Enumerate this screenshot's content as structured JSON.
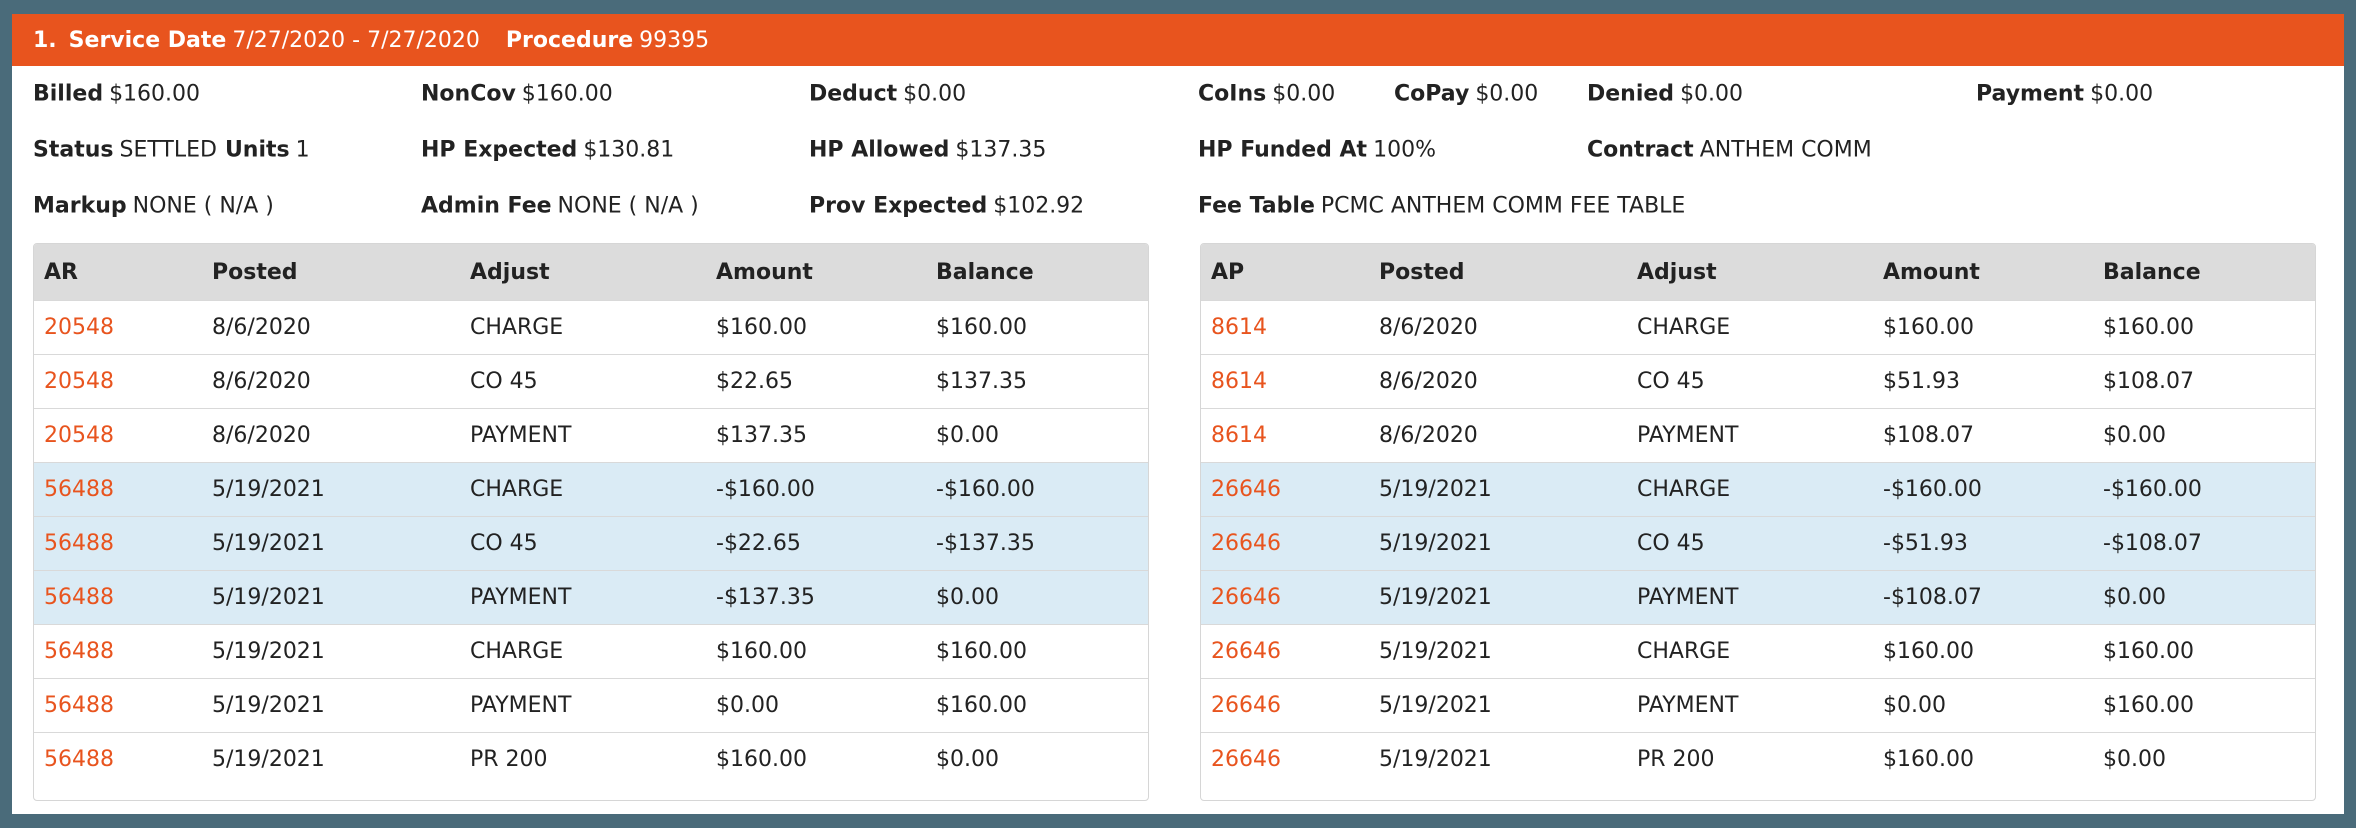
{
  "header": {
    "index": "1.",
    "service_date_label": "Service Date",
    "service_date": "7/27/2020 - 7/27/2020",
    "procedure_label": "Procedure",
    "procedure": "99395"
  },
  "fields": {
    "billed": {
      "label": "Billed",
      "value": "$160.00"
    },
    "noncov": {
      "label": "NonCov",
      "value": "$160.00"
    },
    "deduct": {
      "label": "Deduct",
      "value": "$0.00"
    },
    "coins": {
      "label": "CoIns",
      "value": "$0.00"
    },
    "copay": {
      "label": "CoPay",
      "value": "$0.00"
    },
    "denied": {
      "label": "Denied",
      "value": "$0.00"
    },
    "payment": {
      "label": "Payment",
      "value": "$0.00"
    },
    "status": {
      "label": "Status",
      "value": "SETTLED"
    },
    "units": {
      "label": "Units",
      "value": "1"
    },
    "hp_expected": {
      "label": "HP Expected",
      "value": "$130.81"
    },
    "hp_allowed": {
      "label": "HP Allowed",
      "value": "$137.35"
    },
    "hp_funded_at": {
      "label": "HP Funded At",
      "value": "100%"
    },
    "contract": {
      "label": "Contract",
      "value": "ANTHEM COMM"
    },
    "markup": {
      "label": "Markup",
      "value": "NONE ( N/A )"
    },
    "admin_fee": {
      "label": "Admin Fee",
      "value": "NONE ( N/A )"
    },
    "prov_expected": {
      "label": "Prov Expected",
      "value": "$102.92"
    },
    "fee_table": {
      "label": "Fee Table",
      "value": "PCMC ANTHEM COMM FEE TABLE"
    }
  },
  "ar_table": {
    "headers": [
      "AR",
      "Posted",
      "Adjust",
      "Amount",
      "Balance"
    ],
    "rows": [
      {
        "id": "20548",
        "posted": "8/6/2020",
        "adjust": "CHARGE",
        "amount": "$160.00",
        "balance": "$160.00",
        "highlight": false
      },
      {
        "id": "20548",
        "posted": "8/6/2020",
        "adjust": "CO 45",
        "amount": "$22.65",
        "balance": "$137.35",
        "highlight": false
      },
      {
        "id": "20548",
        "posted": "8/6/2020",
        "adjust": "PAYMENT",
        "amount": "$137.35",
        "balance": "$0.00",
        "highlight": false
      },
      {
        "id": "56488",
        "posted": "5/19/2021",
        "adjust": "CHARGE",
        "amount": "-$160.00",
        "balance": "-$160.00",
        "highlight": true
      },
      {
        "id": "56488",
        "posted": "5/19/2021",
        "adjust": "CO 45",
        "amount": "-$22.65",
        "balance": "-$137.35",
        "highlight": true
      },
      {
        "id": "56488",
        "posted": "5/19/2021",
        "adjust": "PAYMENT",
        "amount": "-$137.35",
        "balance": "$0.00",
        "highlight": true
      },
      {
        "id": "56488",
        "posted": "5/19/2021",
        "adjust": "CHARGE",
        "amount": "$160.00",
        "balance": "$160.00",
        "highlight": false
      },
      {
        "id": "56488",
        "posted": "5/19/2021",
        "adjust": "PAYMENT",
        "amount": "$0.00",
        "balance": "$160.00",
        "highlight": false
      },
      {
        "id": "56488",
        "posted": "5/19/2021",
        "adjust": "PR 200",
        "amount": "$160.00",
        "balance": "$0.00",
        "highlight": false
      }
    ]
  },
  "ap_table": {
    "headers": [
      "AP",
      "Posted",
      "Adjust",
      "Amount",
      "Balance"
    ],
    "rows": [
      {
        "id": "8614",
        "posted": "8/6/2020",
        "adjust": "CHARGE",
        "amount": "$160.00",
        "balance": "$160.00",
        "highlight": false
      },
      {
        "id": "8614",
        "posted": "8/6/2020",
        "adjust": "CO 45",
        "amount": "$51.93",
        "balance": "$108.07",
        "highlight": false
      },
      {
        "id": "8614",
        "posted": "8/6/2020",
        "adjust": "PAYMENT",
        "amount": "$108.07",
        "balance": "$0.00",
        "highlight": false
      },
      {
        "id": "26646",
        "posted": "5/19/2021",
        "adjust": "CHARGE",
        "amount": "-$160.00",
        "balance": "-$160.00",
        "highlight": true
      },
      {
        "id": "26646",
        "posted": "5/19/2021",
        "adjust": "CO 45",
        "amount": "-$51.93",
        "balance": "-$108.07",
        "highlight": true
      },
      {
        "id": "26646",
        "posted": "5/19/2021",
        "adjust": "PAYMENT",
        "amount": "-$108.07",
        "balance": "$0.00",
        "highlight": true
      },
      {
        "id": "26646",
        "posted": "5/19/2021",
        "adjust": "CHARGE",
        "amount": "$160.00",
        "balance": "$160.00",
        "highlight": false
      },
      {
        "id": "26646",
        "posted": "5/19/2021",
        "adjust": "PAYMENT",
        "amount": "$0.00",
        "balance": "$160.00",
        "highlight": false
      },
      {
        "id": "26646",
        "posted": "5/19/2021",
        "adjust": "PR 200",
        "amount": "$160.00",
        "balance": "$0.00",
        "highlight": false
      }
    ]
  },
  "colors": {
    "accent": "#e8541e",
    "highlight_row": "#daebf5",
    "frame": "#4a6b7a"
  }
}
